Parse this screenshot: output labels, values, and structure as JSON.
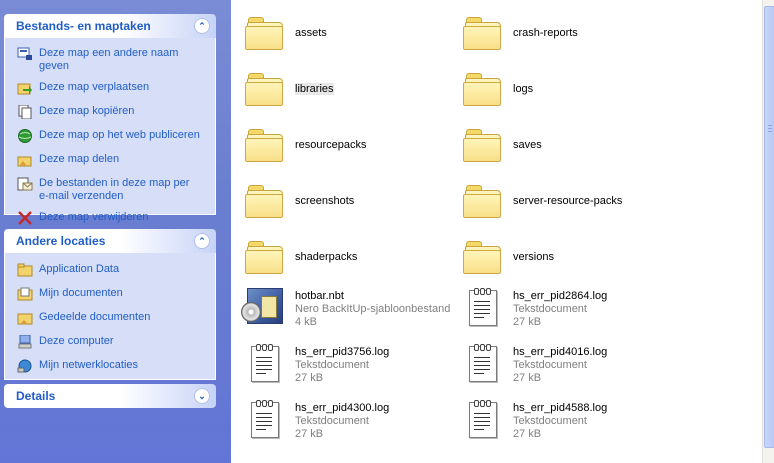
{
  "task_pane": {
    "file_tasks": {
      "title": "Bestands- en maptaken",
      "items": [
        {
          "label": "Deze map een andere naam\ngeven",
          "icon": "rename-icon"
        },
        {
          "label": "Deze map verplaatsen",
          "icon": "move-icon"
        },
        {
          "label": "Deze map kopiëren",
          "icon": "copy-icon"
        },
        {
          "label": "Deze map op het web publiceren",
          "icon": "web-publish-icon"
        },
        {
          "label": "Deze map delen",
          "icon": "share-icon"
        },
        {
          "label": "De bestanden in deze map per\ne-mail verzenden",
          "icon": "email-icon"
        },
        {
          "label": "Deze map verwijderen",
          "icon": "delete-icon"
        }
      ]
    },
    "other_places": {
      "title": "Andere locaties",
      "items": [
        {
          "label": "Application Data",
          "icon": "folder-icon"
        },
        {
          "label": "Mijn documenten",
          "icon": "my-documents-icon"
        },
        {
          "label": "Gedeelde documenten",
          "icon": "shared-folder-icon"
        },
        {
          "label": "Deze computer",
          "icon": "computer-icon"
        },
        {
          "label": "Mijn netwerklocaties",
          "icon": "network-icon"
        }
      ]
    },
    "details": {
      "title": "Details"
    }
  },
  "files": [
    {
      "name": "assets",
      "type": "folder"
    },
    {
      "name": "crash-reports",
      "type": "folder"
    },
    {
      "name": "libraries",
      "type": "folder",
      "selected": true
    },
    {
      "name": "logs",
      "type": "folder"
    },
    {
      "name": "resourcepacks",
      "type": "folder"
    },
    {
      "name": "saves",
      "type": "folder"
    },
    {
      "name": "screenshots",
      "type": "folder"
    },
    {
      "name": "server-resource-packs",
      "type": "folder"
    },
    {
      "name": "shaderpacks",
      "type": "folder"
    },
    {
      "name": "versions",
      "type": "folder"
    },
    {
      "name": "hotbar.nbt",
      "type": "nero",
      "kind": "Nero BackItUp-sjabloonbestand",
      "size": "4 kB"
    },
    {
      "name": "hs_err_pid2864.log",
      "type": "text",
      "kind": "Tekstdocument",
      "size": "27 kB"
    },
    {
      "name": "hs_err_pid3756.log",
      "type": "text",
      "kind": "Tekstdocument",
      "size": "27 kB"
    },
    {
      "name": "hs_err_pid4016.log",
      "type": "text",
      "kind": "Tekstdocument",
      "size": "27 kB"
    },
    {
      "name": "hs_err_pid4300.log",
      "type": "text",
      "kind": "Tekstdocument",
      "size": "27 kB"
    },
    {
      "name": "hs_err_pid4588.log",
      "type": "text",
      "kind": "Tekstdocument",
      "size": "27 kB"
    }
  ],
  "colors": {
    "pane_background": "#6b7fd0",
    "panel_title": "#215dc6",
    "panel_body": "#d6dff7",
    "link": "#215dc6",
    "file_subtext": "#808080",
    "folder_yellow": "#f7de7a"
  }
}
